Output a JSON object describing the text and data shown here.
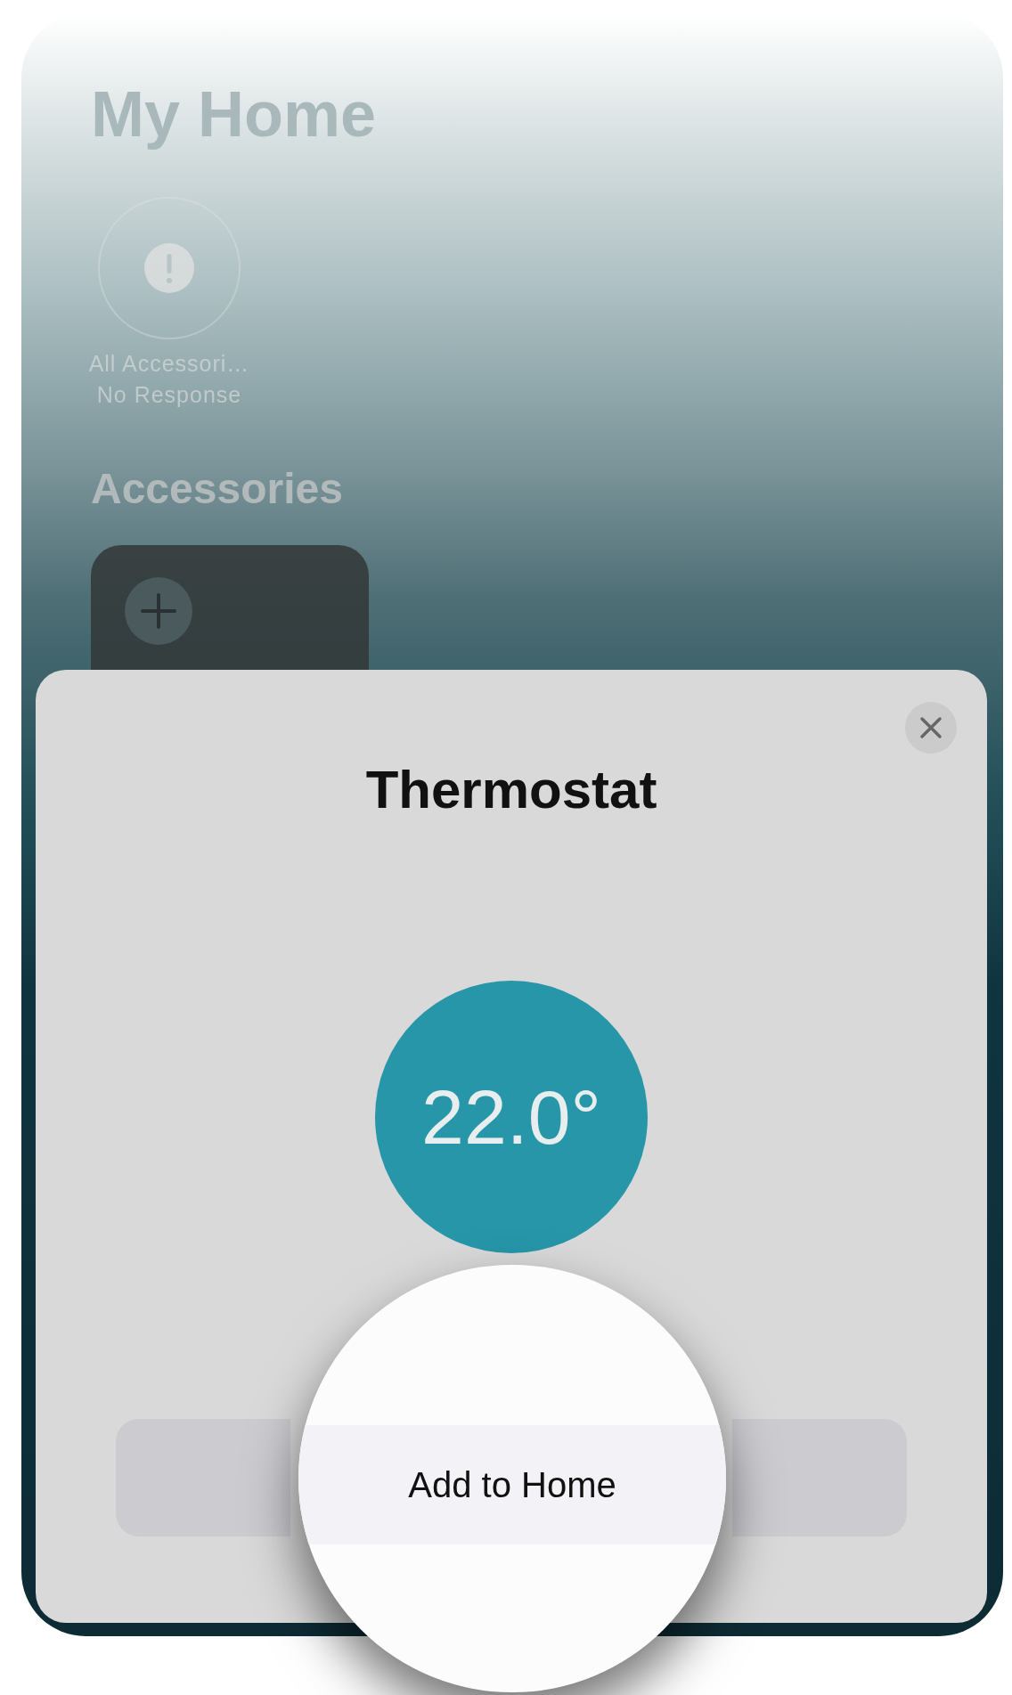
{
  "header": {
    "title": "My Home"
  },
  "status_tile": {
    "title": "All Accessori…",
    "subtitle": "No Response"
  },
  "accessories": {
    "title": "Accessories"
  },
  "sheet": {
    "title": "Thermostat",
    "temperature": "22.0°",
    "button": "Add to Home"
  }
}
